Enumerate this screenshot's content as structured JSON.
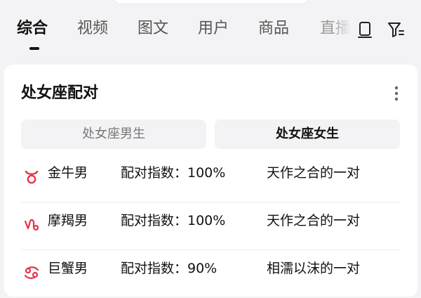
{
  "tabs": [
    {
      "label": "综合",
      "active": true
    },
    {
      "label": "视频",
      "active": false
    },
    {
      "label": "图文",
      "active": false
    },
    {
      "label": "用户",
      "active": false
    },
    {
      "label": "商品",
      "active": false
    },
    {
      "label": "直播",
      "active": false
    }
  ],
  "top_icons": {
    "screen": "tablet-icon",
    "filter": "filter-icon"
  },
  "card": {
    "title": "处女座配对",
    "more_icon": "more-vertical-icon",
    "segments": {
      "male": "处女座男生",
      "female": "处女座女生",
      "selected": "female"
    },
    "rows": [
      {
        "icon": "taurus-icon",
        "name": "金牛男",
        "index_label": "配对指数：100%",
        "description": "天作之合的一对"
      },
      {
        "icon": "capricorn-icon",
        "name": "摩羯男",
        "index_label": "配对指数：100%",
        "description": "天作之合的一对"
      },
      {
        "icon": "cancer-icon",
        "name": "巨蟹男",
        "index_label": "配对指数：90%",
        "description": "相濡以沫的一对"
      }
    ]
  },
  "colors": {
    "accent_red": "#e8334a",
    "background": "#f3f3f5",
    "card": "#ffffff"
  }
}
